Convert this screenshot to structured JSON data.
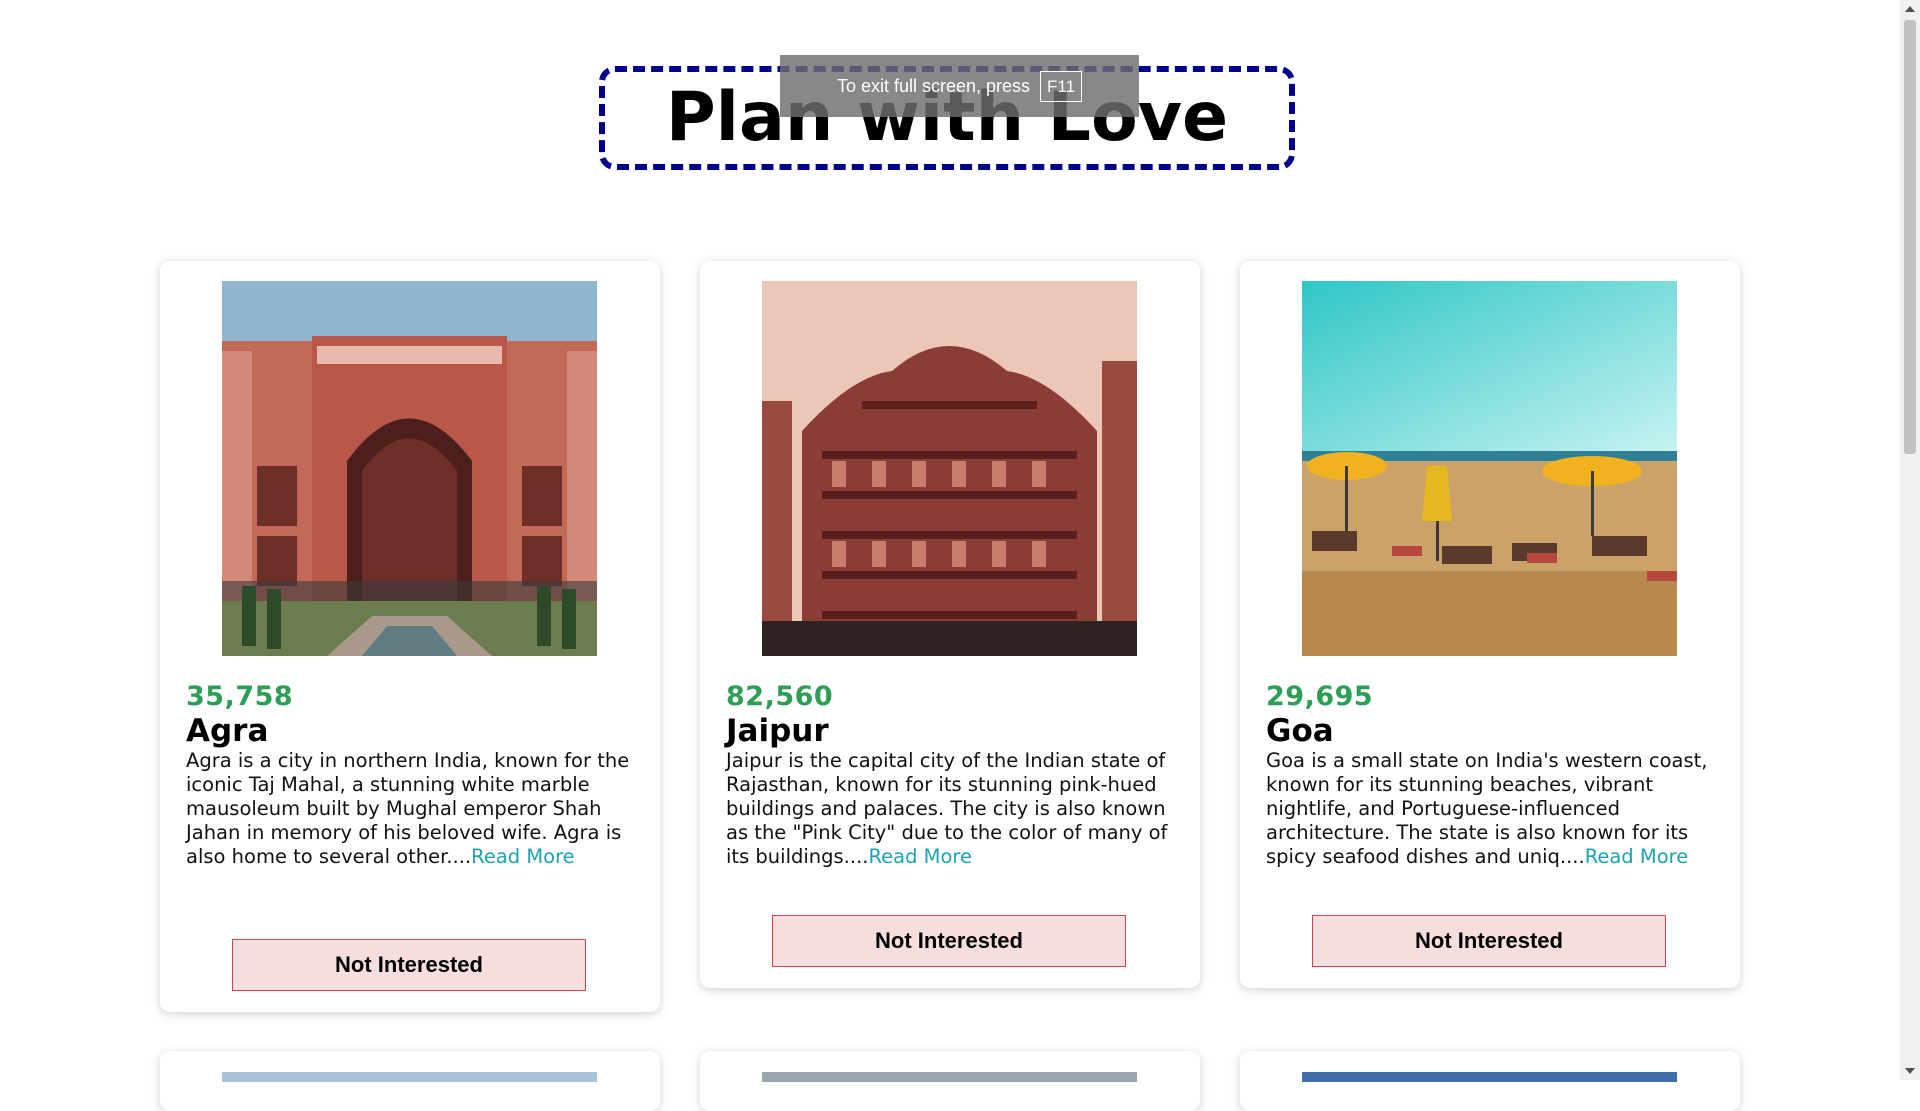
{
  "page": {
    "title": "Plan with Love"
  },
  "fullscreen_toast": {
    "text": "To exit full screen, press",
    "key": "F11"
  },
  "cards": [
    {
      "count": "35,758",
      "city": "Agra",
      "description": "Agra is a city in northern India, known for the iconic Taj Mahal, a stunning white marble mausoleum built by Mughal emperor Shah Jahan in memory of his beloved wife. Agra is also home to several other....",
      "read_more": "Read More",
      "button": "Not Interested",
      "image_icon": "taj-mahal-gate-image"
    },
    {
      "count": "82,560",
      "city": "Jaipur",
      "description": "Jaipur is the capital city of the Indian state of Rajasthan, known for its stunning pink-hued buildings and palaces. The city is also known as the \"Pink City\" due to the color of many of its buildings....",
      "read_more": "Read More",
      "button": "Not Interested",
      "image_icon": "hawa-mahal-image"
    },
    {
      "count": "29,695",
      "city": "Goa",
      "description": "Goa is a small state on India's western coast, known for its stunning beaches, vibrant nightlife, and Portuguese-influenced architecture. The state is also known for its spicy seafood dishes and uniq....",
      "read_more": "Read More",
      "button": "Not Interested",
      "image_icon": "beach-umbrellas-image"
    }
  ],
  "colors": {
    "title_border": "#00008b",
    "count": "#2e9e57",
    "read_more_link": "#1ba3b3",
    "button_bg": "#f6dede",
    "button_border": "#d1434f"
  }
}
